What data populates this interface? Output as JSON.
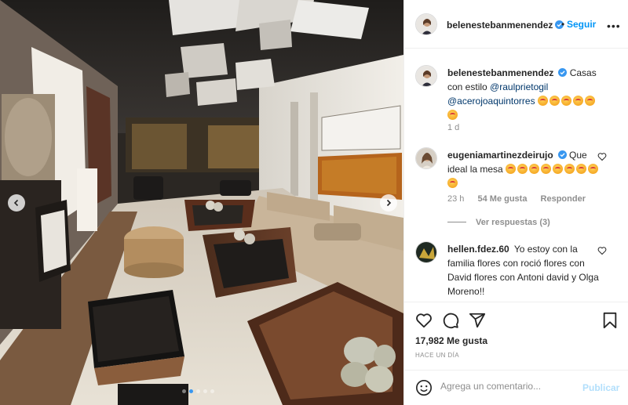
{
  "post": {
    "username": "belenestebanmenendez",
    "follow_label": "Seguir",
    "separator": "•",
    "more_label": "•••",
    "caption": {
      "text": "Casas con estilo",
      "mention1": "@raulprietogil",
      "mention2": "@acerojoaquintorres"
    },
    "caption_time": "1 d",
    "photo_position": {
      "current": 1,
      "total": 5
    },
    "likes": "17,982 Me gusta",
    "posted": "HACE UN DÍA"
  },
  "comments": [
    {
      "username": "eugeniamartinezdeirujo",
      "text": "Que ideal la mesa",
      "time": "23 h",
      "likes": "54 Me gusta",
      "reply": "Responder",
      "view_replies": "Ver respuestas (3)"
    },
    {
      "username": "hellen.fdez.60",
      "text": "Yo estoy con la familia flores con roció flores con David flores con Antoni david y Olga Moreno!!"
    }
  ],
  "add_comment": {
    "placeholder": "Agrega un comentario...",
    "publish_label": "Publicar"
  },
  "icons": [
    "verified-badge-icon",
    "heart-icon",
    "comment-icon",
    "share-icon",
    "bookmark-icon",
    "emoji-icon",
    "arrow-left-icon",
    "arrow-right-icon",
    "more-options-icon"
  ],
  "colors": {
    "accent": "#0095f6",
    "publish_disabled": "#b2dffc",
    "text": "#262626",
    "muted": "#8e8e8e",
    "border": "#efefef"
  }
}
